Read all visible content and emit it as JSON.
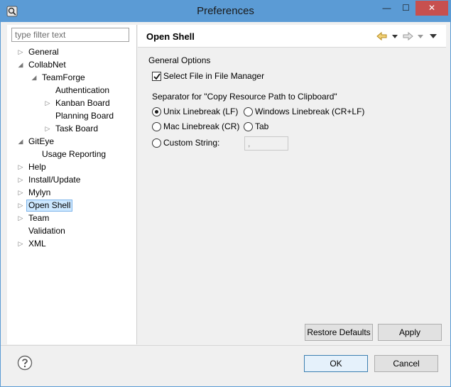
{
  "window": {
    "title": "Preferences",
    "min_symbol": "—",
    "max_symbol": "☐",
    "close_symbol": "✕"
  },
  "filter": {
    "placeholder": "type filter text",
    "value": ""
  },
  "tree": {
    "items": [
      {
        "label": "General",
        "arrow": "▷"
      },
      {
        "label": "CollabNet",
        "arrow": "◢"
      },
      {
        "label": "TeamForge",
        "arrow": "◢"
      },
      {
        "label": "Authentication",
        "arrow": ""
      },
      {
        "label": "Kanban Board",
        "arrow": "▷"
      },
      {
        "label": "Planning Board",
        "arrow": ""
      },
      {
        "label": "Task Board",
        "arrow": "▷"
      },
      {
        "label": "GitEye",
        "arrow": "◢"
      },
      {
        "label": "Usage Reporting",
        "arrow": ""
      },
      {
        "label": "Help",
        "arrow": "▷"
      },
      {
        "label": "Install/Update",
        "arrow": "▷"
      },
      {
        "label": "Mylyn",
        "arrow": "▷"
      },
      {
        "label": "Open Shell",
        "arrow": "▷",
        "selected": true
      },
      {
        "label": "Team",
        "arrow": "▷"
      },
      {
        "label": "Validation",
        "arrow": ""
      },
      {
        "label": "XML",
        "arrow": "▷"
      }
    ]
  },
  "page": {
    "title": "Open Shell",
    "section_title": "General Options",
    "select_file_label": "Select File in File Manager",
    "select_file_checked": true,
    "separator_label": "Separator for \"Copy Resource Path to Clipboard\"",
    "radios": {
      "unix": "Unix Linebreak (LF)",
      "windows": "Windows Linebreak (CR+LF)",
      "mac": "Mac Linebreak (CR)",
      "tab": "Tab",
      "custom": "Custom String:"
    },
    "selected_radio": "unix",
    "custom_value": ","
  },
  "buttons": {
    "restore": "Restore Defaults",
    "apply": "Apply",
    "ok": "OK",
    "cancel": "Cancel"
  },
  "colors": {
    "titlebar": "#5b9bd5",
    "close": "#c7504f",
    "selection": "#cde8ff"
  }
}
